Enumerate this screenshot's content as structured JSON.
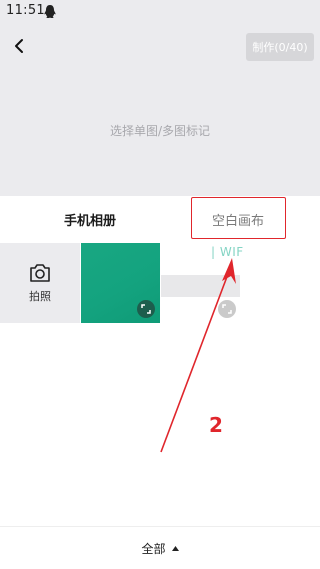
{
  "status_bar": {
    "time": "11:51",
    "notification_icon": "qq-penguin-icon"
  },
  "header": {
    "back_icon": "chevron-left-icon",
    "make_button_label": "制作(0/40)"
  },
  "hint": "选择单图/多图标记",
  "tabs": [
    {
      "label": "手机相册",
      "active": true
    },
    {
      "label": "空白画布",
      "active": false
    }
  ],
  "grid": {
    "camera_label": "拍照",
    "camera_icon": "camera-icon",
    "blank_canvas_text": "| WIF",
    "expand_icon": "expand-icon"
  },
  "annotation": {
    "step_number": "2",
    "color": "#e0262c"
  },
  "footer": {
    "filter_label": "全部",
    "caret_icon": "caret-up-icon"
  },
  "colors": {
    "accent_green": "#14a37f",
    "annotation_red": "#e0262c",
    "background_gray": "#ebebee"
  }
}
